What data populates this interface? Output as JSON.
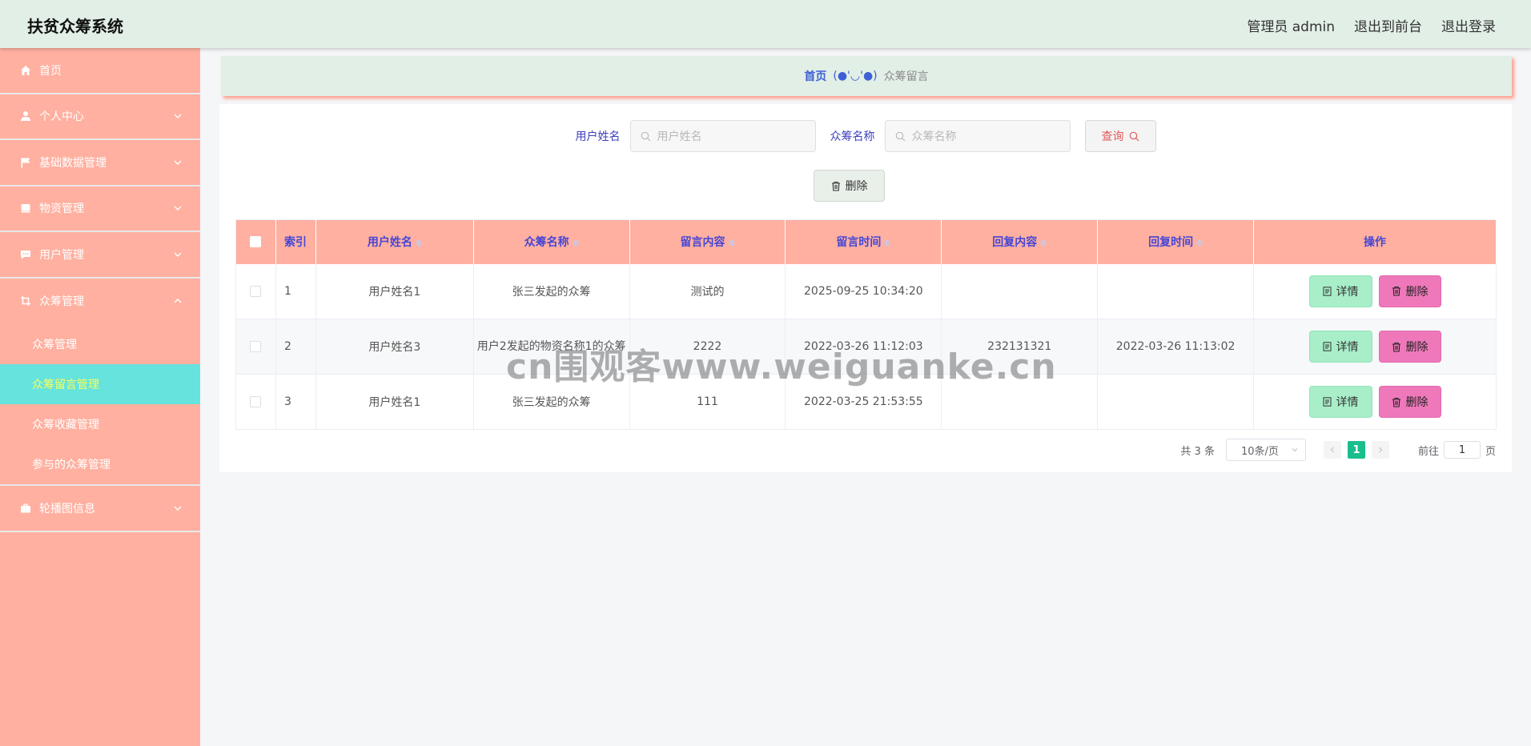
{
  "header": {
    "title": "扶贫众筹系统",
    "user": "管理员 admin",
    "to_front": "退出到前台",
    "logout": "退出登录"
  },
  "sidebar": {
    "items": [
      {
        "label": "首页",
        "icon": "home-icon"
      },
      {
        "label": "个人中心",
        "icon": "user-icon"
      },
      {
        "label": "基础数据管理",
        "icon": "flag-icon"
      },
      {
        "label": "物资管理",
        "icon": "box-icon"
      },
      {
        "label": "用户管理",
        "icon": "chat-icon"
      },
      {
        "label": "众筹管理",
        "icon": "crop-icon"
      },
      {
        "label": "轮播图信息",
        "icon": "briefcase-icon"
      }
    ],
    "submenu": [
      "众筹管理",
      "众筹留言管理",
      "众筹收藏管理",
      "参与的众筹管理"
    ]
  },
  "breadcrumb": {
    "home": "首页",
    "face": "(●'◡'●)",
    "current": "众筹留言"
  },
  "search": {
    "user_label": "用户姓名",
    "user_placeholder": "用户姓名",
    "project_label": "众筹名称",
    "project_placeholder": "众筹名称",
    "query_label": "查询"
  },
  "toolbar": {
    "delete_label": "删除"
  },
  "table": {
    "columns": [
      "索引",
      "用户姓名",
      "众筹名称",
      "留言内容",
      "留言时间",
      "回复内容",
      "回复时间",
      "操作"
    ],
    "rows": [
      {
        "index": "1",
        "user": "用户姓名1",
        "project": "张三发起的众筹",
        "message": "测试的",
        "msg_time": "2025-09-25 10:34:20",
        "reply": "",
        "reply_time": ""
      },
      {
        "index": "2",
        "user": "用户姓名3",
        "project": "用户2发起的物资名称1的众筹",
        "message": "2222",
        "msg_time": "2022-03-26 11:12:03",
        "reply": "232131321",
        "reply_time": "2022-03-26 11:13:02"
      },
      {
        "index": "3",
        "user": "用户姓名1",
        "project": "张三发起的众筹",
        "message": "111",
        "msg_time": "2022-03-25 21:53:55",
        "reply": "",
        "reply_time": ""
      }
    ],
    "detail_label": "详情",
    "delete_label": "删除"
  },
  "pagination": {
    "total": "共 3 条",
    "page_size": "10条/页",
    "current": "1",
    "goto_prefix": "前往",
    "goto_value": "1",
    "goto_suffix": "页"
  },
  "watermark": "cn围观客www.weiguanke.cn",
  "colors": {
    "header_bg": "#e1efe6",
    "sidebar_bg": "#ffb0a0",
    "active_sub_bg": "#66e3dc",
    "detail_btn": "#a8eec9",
    "delete_btn": "#ee78ba",
    "pager_active": "#19be8c"
  }
}
